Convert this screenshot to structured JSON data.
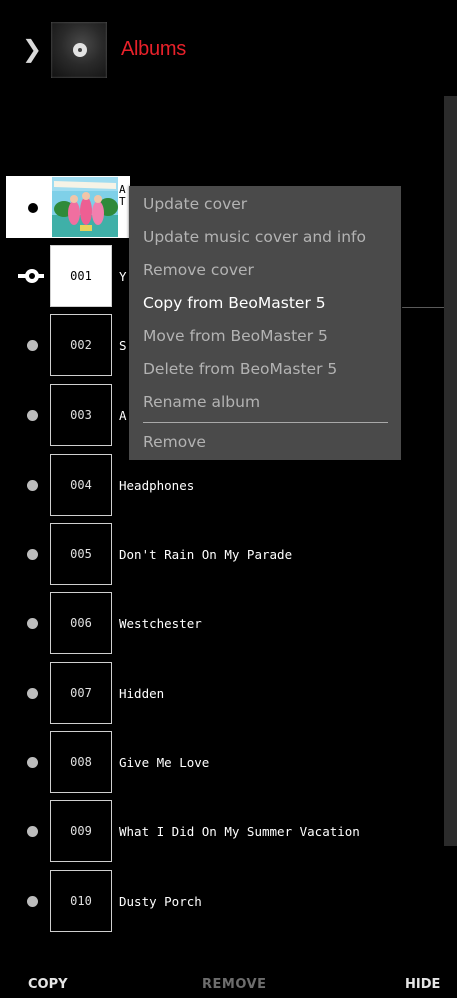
{
  "header": {
    "title": "Albums"
  },
  "album": {
    "line1": "A",
    "line2": "T"
  },
  "tracks": [
    {
      "num": "001",
      "name": "Y"
    },
    {
      "num": "002",
      "name": "S"
    },
    {
      "num": "003",
      "name": "A"
    },
    {
      "num": "004",
      "name": "Headphones"
    },
    {
      "num": "005",
      "name": "Don't Rain On My Parade"
    },
    {
      "num": "006",
      "name": "Westchester"
    },
    {
      "num": "007",
      "name": "Hidden"
    },
    {
      "num": "008",
      "name": "Give Me Love"
    },
    {
      "num": "009",
      "name": "What I Did On My Summer Vacation"
    },
    {
      "num": "010",
      "name": "Dusty Porch"
    }
  ],
  "menu": {
    "items": [
      "Update cover",
      "Update music cover and info",
      "Remove cover",
      "Copy from BeoMaster 5",
      "Move from BeoMaster 5",
      "Delete from BeoMaster 5",
      "Rename album"
    ],
    "remove": "Remove",
    "active_index": 3
  },
  "footer": {
    "copy": "COPY",
    "remove": "REMOVE",
    "hide": "HIDE"
  },
  "colors": {
    "title": "#e8212a",
    "menu_bg": "#4a4a4a",
    "menu_text": "#b3b3b3",
    "menu_active": "#ffffff"
  }
}
